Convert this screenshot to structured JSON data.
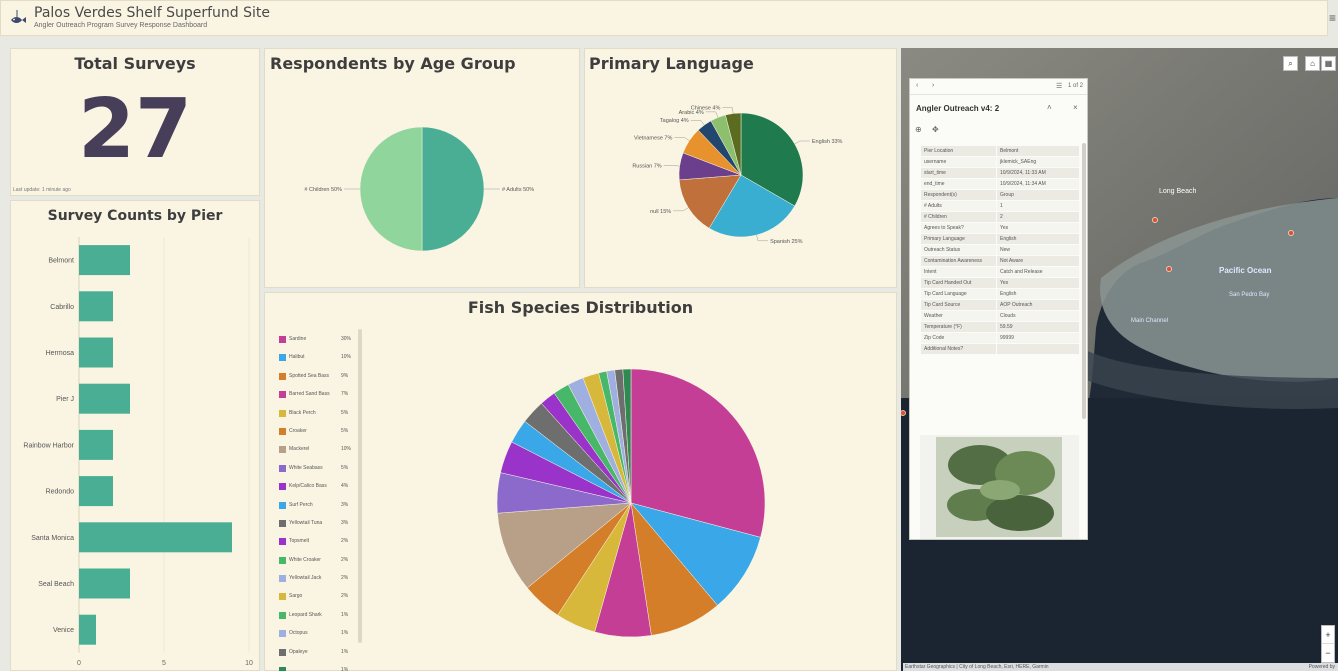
{
  "header": {
    "title": "Palos Verdes Shelf Superfund Site",
    "subtitle": "Angler Outreach Program Survey Response Dashboard",
    "menu_icon": "menu-icon"
  },
  "total": {
    "title": "Total Surveys",
    "value": "27",
    "last_update": "Last update: 1 minute ago"
  },
  "pier_chart": {
    "title": "Survey Counts by Pier",
    "chart_data": {
      "type": "bar",
      "orientation": "horizontal",
      "categories": [
        "Belmont",
        "Cabrillo",
        "Hermosa",
        "Pier J",
        "Rainbow Harbor",
        "Redondo",
        "Santa Monica",
        "Seal Beach",
        "Venice"
      ],
      "values": [
        3,
        2,
        2,
        3,
        2,
        2,
        9,
        3,
        1
      ],
      "xlim": [
        0,
        10
      ],
      "xticks": [
        "0",
        "5",
        "10"
      ],
      "color": "#4aae94"
    }
  },
  "age_chart": {
    "title": "Respondents by Age Group",
    "chart_data": {
      "type": "pie",
      "slices": [
        {
          "label": "# Adults 50%",
          "value": 50,
          "color": "#4aae94"
        },
        {
          "label": "# Children 50%",
          "value": 50,
          "color": "#8fd59c"
        }
      ]
    }
  },
  "language_chart": {
    "title": "Primary Language",
    "chart_data": {
      "type": "pie",
      "slices": [
        {
          "label": "English 33%",
          "value": 33,
          "color": "#1f7a4d"
        },
        {
          "label": "Spanish 25%",
          "value": 25,
          "color": "#3aaed0"
        },
        {
          "label": "null 15%",
          "value": 15,
          "color": "#c0703b"
        },
        {
          "label": "Russian 7%",
          "value": 7,
          "color": "#6b3f8c"
        },
        {
          "label": "Vietnamese 7%",
          "value": 7,
          "color": "#e8922e"
        },
        {
          "label": "Tagalog 4%",
          "value": 4,
          "color": "#22466e"
        },
        {
          "label": "Arabic 4%",
          "value": 4,
          "color": "#8cc06e"
        },
        {
          "label": "Chinese 4%",
          "value": 4,
          "color": "#5b6b1f"
        }
      ]
    }
  },
  "fish_chart": {
    "title": "Fish Species Distribution",
    "chart_data": {
      "type": "pie",
      "slices": [
        {
          "label": "Sardine",
          "pct": "30%",
          "value": 30,
          "color": "#c43e96"
        },
        {
          "label": "Halibut",
          "pct": "10%",
          "value": 10,
          "color": "#3aa8e8"
        },
        {
          "label": "Spotted Sea Bass",
          "pct": "9%",
          "value": 9,
          "color": "#d57e2a"
        },
        {
          "label": "Barred Sand Bass",
          "pct": "7%",
          "value": 7,
          "color": "#c43e96"
        },
        {
          "label": "Black Perch",
          "pct": "5%",
          "value": 5,
          "color": "#d8b83a"
        },
        {
          "label": "Croaker",
          "pct": "5%",
          "value": 5,
          "color": "#d57e2a"
        },
        {
          "label": "Mackerel",
          "pct": "10%",
          "value": 10,
          "color": "#b8a088"
        },
        {
          "label": "White Seabass",
          "pct": "5%",
          "value": 5,
          "color": "#8c6acc"
        },
        {
          "label": "Kelp/Calico Bass",
          "pct": "4%",
          "value": 4,
          "color": "#9a33c9"
        },
        {
          "label": "Surf Perch",
          "pct": "3%",
          "value": 3,
          "color": "#3aa8e8"
        },
        {
          "label": "Yellowtail Tuna",
          "pct": "3%",
          "value": 3,
          "color": "#6e6e6e"
        },
        {
          "label": "Topsmelt",
          "pct": "2%",
          "value": 2,
          "color": "#9a33c9"
        },
        {
          "label": "White Croaker",
          "pct": "2%",
          "value": 2,
          "color": "#47b86a"
        },
        {
          "label": "Yellowtail Jack",
          "pct": "2%",
          "value": 2,
          "color": "#9fb0e0"
        },
        {
          "label": "Sargo",
          "pct": "2%",
          "value": 2,
          "color": "#d8b83a"
        },
        {
          "label": "Leopard Shark",
          "pct": "1%",
          "value": 1,
          "color": "#47b86a"
        },
        {
          "label": "Octopus",
          "pct": "1%",
          "value": 1,
          "color": "#9fb0e0"
        },
        {
          "label": "Opaleye",
          "pct": "1%",
          "value": 1,
          "color": "#6e6e6e"
        },
        {
          "label": "",
          "pct": "1%",
          "value": 1,
          "color": "#2e8a52"
        }
      ]
    }
  },
  "map": {
    "labels": {
      "long_beach": "Long Beach",
      "pacific_ocean": "Pacific Ocean",
      "san_pedro_bay": "San Pedro Bay",
      "main_channel": "Main Channel"
    },
    "attribution": "Earthstar Geographics | City of Long Beach, Esri, HERE, Garmin",
    "powered_by": "Powered by",
    "zoom_in": "+",
    "zoom_out": "−"
  },
  "popup": {
    "pager": "1 of 2",
    "title": "Angler Outreach v4: 2",
    "fields": [
      {
        "k": "Pier Location",
        "v": "Belmont"
      },
      {
        "k": "username",
        "v": "jklemick_SAEng"
      },
      {
        "k": "start_time",
        "v": "10/9/2024, 11:33 AM"
      },
      {
        "k": "end_time",
        "v": "10/9/2024, 11:34 AM"
      },
      {
        "k": "Respondent(s)",
        "v": "Group"
      },
      {
        "k": "# Adults",
        "v": "1"
      },
      {
        "k": "# Children",
        "v": "2"
      },
      {
        "k": "Agrees to Speak?",
        "v": "Yes"
      },
      {
        "k": "Primary Language",
        "v": "English"
      },
      {
        "k": "Outreach Status",
        "v": "New"
      },
      {
        "k": "Contamination Awareness",
        "v": "Not Aware"
      },
      {
        "k": "Intent",
        "v": "Catch and Release"
      },
      {
        "k": "Tip Card Handed Out",
        "v": "Yes"
      },
      {
        "k": "Tip Card Language",
        "v": "English"
      },
      {
        "k": "Tip Card Source",
        "v": "AOP Outreach"
      },
      {
        "k": "Weather",
        "v": "Clouds"
      },
      {
        "k": "Temperature (°F)",
        "v": "59.59"
      },
      {
        "k": "Zip Code",
        "v": "99999"
      },
      {
        "k": "Additional Notes?",
        "v": ""
      }
    ]
  }
}
